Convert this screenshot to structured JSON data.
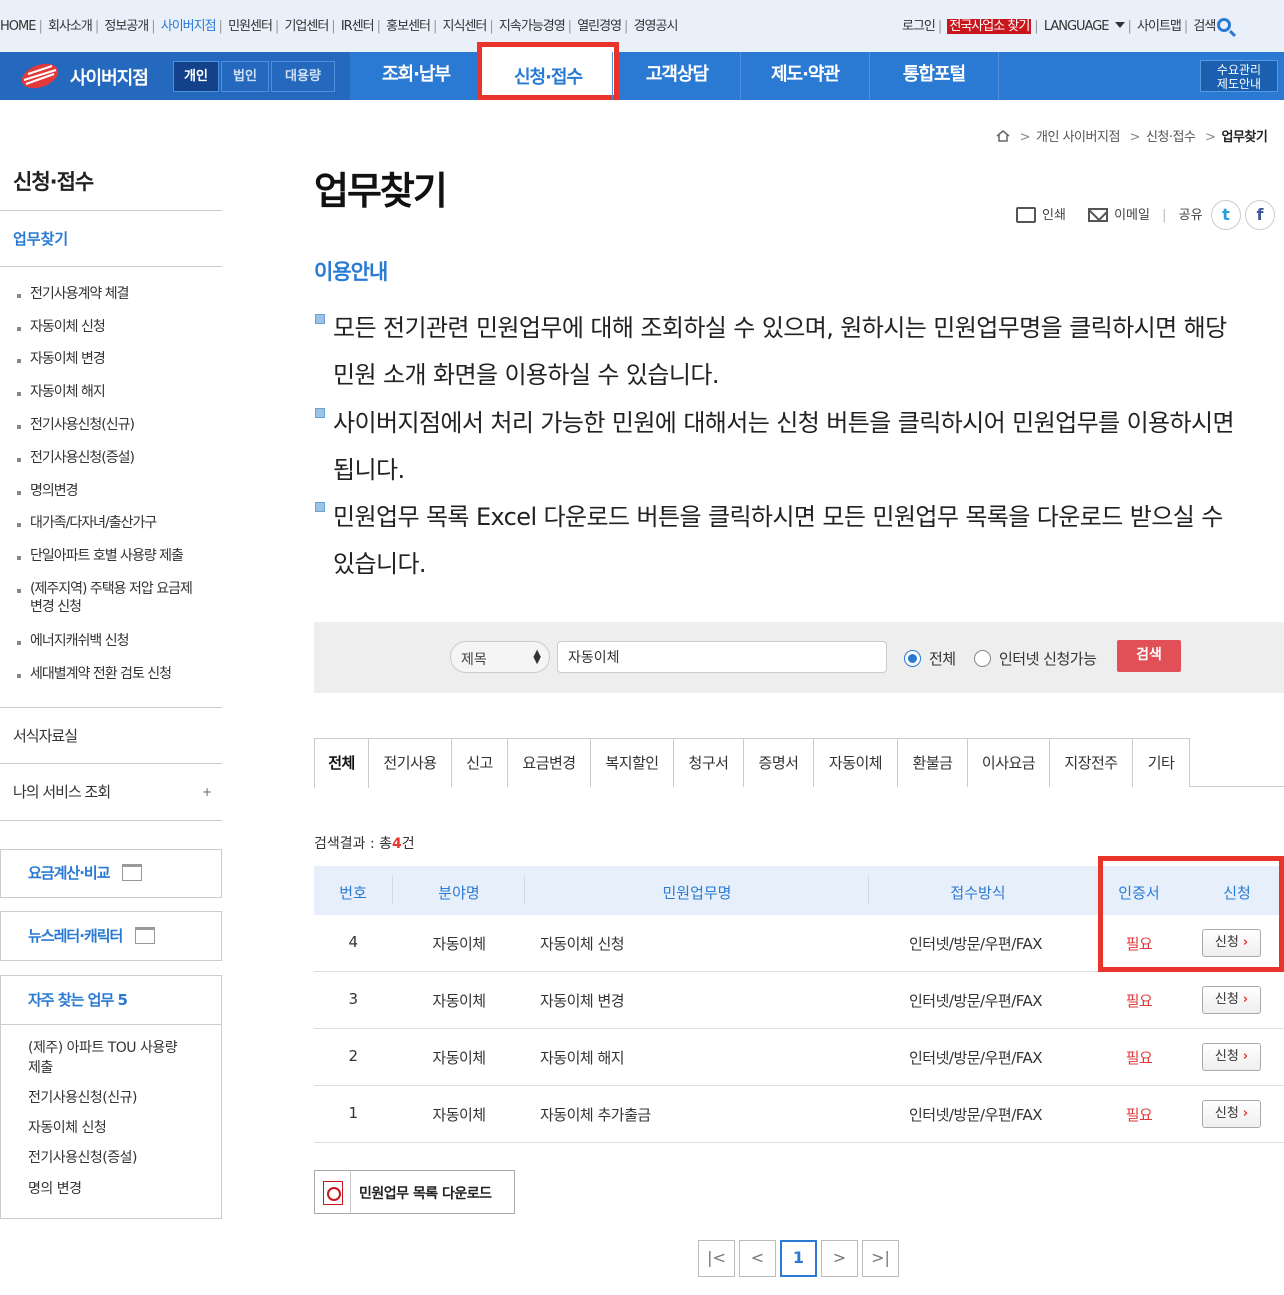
{
  "utility_nav": {
    "left": [
      "HOME",
      "회사소개",
      "정보공개",
      "사이버지점",
      "민원센터",
      "기업센터",
      "IR센터",
      "홍보센터",
      "지식센터",
      "지속가능경영",
      "열린경영",
      "경영공시"
    ],
    "active": "사이버지점",
    "login": "로그인",
    "find_office": "전국사업소 찾기",
    "language": "LANGUAGE",
    "sitemap": "사이트맵",
    "search": "검색"
  },
  "gnb": {
    "brand": "사이버지점",
    "segments": [
      "개인",
      "법인",
      "대용량"
    ],
    "menus": [
      "조회·납부",
      "신청·접수",
      "고객상담",
      "제도·약관",
      "통합포털"
    ],
    "active_menu": "신청·접수",
    "demand_line1": "수요관리",
    "demand_line2": "제도안내"
  },
  "breadcrumb": [
    "개인 사이버지점",
    "신청·접수",
    "업무찾기"
  ],
  "sidebar": {
    "title": "신청·접수",
    "active_sub": "업무찾기",
    "items": [
      "전기사용계약 체결",
      "자동이체 신청",
      "자동이체 변경",
      "자동이체 해지",
      "전기사용신청(신규)",
      "전기사용신청(증설)",
      "명의변경",
      "대가족/다자녀/출산가구",
      "단일아파트 호별 사용량 제출",
      "(제주지역) 주택용 저압 요금제",
      "변경 신청",
      "에너지캐쉬백 신청",
      "세대별계약 전환 검토 신청"
    ],
    "sections": [
      "서식자료실",
      "나의 서비스 조회"
    ],
    "plus": "+",
    "box1": "요금계산·비교",
    "box2": "뉴스레터·캐릭터",
    "freq_title": "자주 찾는 업무 5",
    "freq_items": [
      "(제주) 아파트 TOU 사용량",
      "제출",
      "전기사용신청(신규)",
      "자동이체 신청",
      "전기사용신청(증설)",
      "명의 변경"
    ]
  },
  "page": {
    "title": "업무찾기",
    "print": "인쇄",
    "email": "이메일",
    "share": "공유",
    "twitter": "t",
    "facebook": "f",
    "guide_title": "이용안내",
    "guide_lines": [
      "모든 전기관련 민원업무에 대해 조회하실 수 있으며, 원하시는 민원업무명을 클릭하시면 해당",
      "민원 소개 화면을 이용하실 수 있습니다.",
      "사이버지점에서 처리 가능한 민원에 대해서는 신청 버튼을 클릭하시어 민원업무를 이용하시면",
      "됩니다.",
      "민원업무 목록 Excel 다운로드 버튼을 클릭하시면 모든 민원업무 목록을 다운로드 받으실 수",
      "있습니다."
    ]
  },
  "search": {
    "select_value": "제목",
    "input_value": "자동이체",
    "radio_all": "전체",
    "radio_online": "인터넷 신청가능",
    "button": "검색"
  },
  "tabs": [
    "전체",
    "전기사용",
    "신고",
    "요금변경",
    "복지할인",
    "청구서",
    "증명서",
    "자동이체",
    "환불금",
    "이사요금",
    "지장전주",
    "기타"
  ],
  "results": {
    "label_prefix": "검색결과 : 총",
    "count": "4",
    "label_suffix": "건",
    "headers": [
      "번호",
      "분야명",
      "민원업무명",
      "접수방식",
      "인증서",
      "신청"
    ],
    "rows": [
      {
        "no": "4",
        "field": "자동이체",
        "name": "자동이체 신청",
        "method": "인터넷/방문/우편/FAX",
        "cert": "필요",
        "apply": "신청"
      },
      {
        "no": "3",
        "field": "자동이체",
        "name": "자동이체 변경",
        "method": "인터넷/방문/우편/FAX",
        "cert": "필요",
        "apply": "신청"
      },
      {
        "no": "2",
        "field": "자동이체",
        "name": "자동이체 해지",
        "method": "인터넷/방문/우편/FAX",
        "cert": "필요",
        "apply": "신청"
      },
      {
        "no": "1",
        "field": "자동이체",
        "name": "자동이체 추가출금",
        "method": "인터넷/방문/우편/FAX",
        "cert": "필요",
        "apply": "신청"
      }
    ]
  },
  "download_label": "민원업무 목록 다운로드",
  "pagination": {
    "first": "|<",
    "prev": "<",
    "current": "1",
    "next": ">",
    "last": ">|"
  },
  "colors": {
    "primary": "#2a7ad4",
    "highlight": "#e8342b",
    "search_button": "#e15056"
  }
}
